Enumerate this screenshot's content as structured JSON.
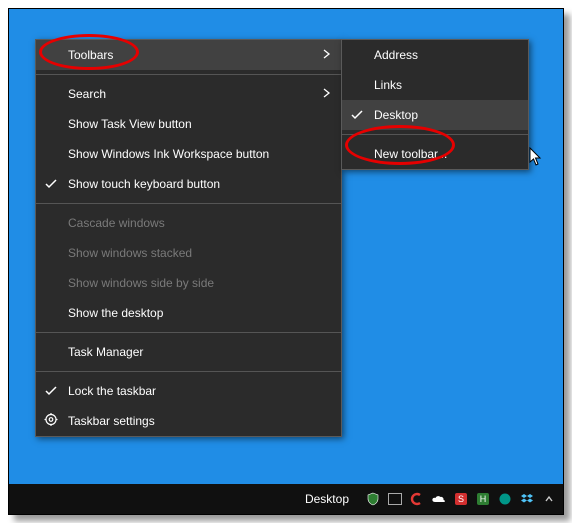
{
  "mainMenu": {
    "toolbars": "Toolbars",
    "search": "Search",
    "showTaskView": "Show Task View button",
    "showInk": "Show Windows Ink Workspace button",
    "showTouch": "Show touch keyboard button",
    "cascade": "Cascade windows",
    "stacked": "Show windows stacked",
    "sideBySide": "Show windows side by side",
    "showDesktop": "Show the desktop",
    "taskManager": "Task Manager",
    "lockTaskbar": "Lock the taskbar",
    "taskbarSettings": "Taskbar settings"
  },
  "subMenu": {
    "address": "Address",
    "links": "Links",
    "desktop": "Desktop",
    "newToolbar": "New toolbar..."
  },
  "taskbar": {
    "desktopLabel": "Desktop"
  },
  "colors": {
    "highlight": "#e60000"
  }
}
